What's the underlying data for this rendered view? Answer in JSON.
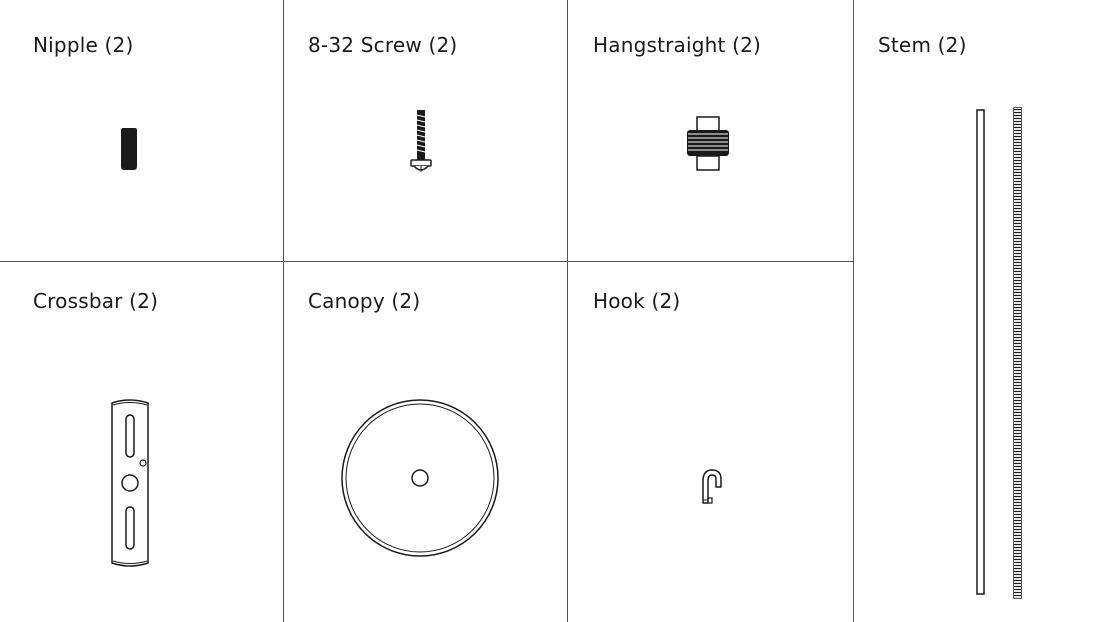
{
  "parts": {
    "nipple": {
      "label": "Nipple (2)"
    },
    "screw": {
      "label": "8-32 Screw (2)"
    },
    "hangstraight": {
      "label": "Hangstraight (2)"
    },
    "stem": {
      "label": "Stem (2)"
    },
    "crossbar": {
      "label": "Crossbar (2)"
    },
    "canopy": {
      "label": "Canopy (2)"
    },
    "hook": {
      "label": "Hook (2)"
    }
  },
  "colors": {
    "divider": "#555555",
    "ink": "#1a1a1a",
    "part_outline": "#333333"
  }
}
